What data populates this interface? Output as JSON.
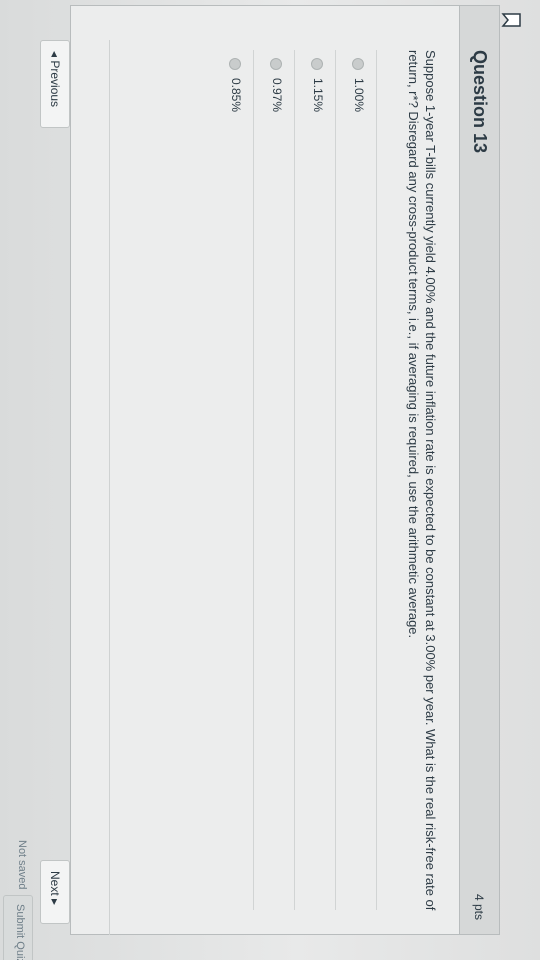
{
  "question": {
    "title": "Question 13",
    "points": "4 pts",
    "text": "Suppose 1-year T-bills currently yield 4.00% and the future inflation rate is expected to be constant at 3.00% per year. What is the real risk-free rate of return, r*? Disregard any cross-product terms, i.e., if averaging is required, use the arithmetic average."
  },
  "answers": [
    {
      "label": "1.00%"
    },
    {
      "label": "1.15%"
    },
    {
      "label": "0.97%"
    },
    {
      "label": "0.85%"
    }
  ],
  "nav": {
    "previous_label": "◂ Previous",
    "next_label": "Next ▸"
  },
  "footer": {
    "status": "Not saved",
    "submit_label": "Submit Quiz"
  },
  "colors": {
    "text": "#2d3b45",
    "header_bg": "#d6d8d8",
    "border": "#b8bcbd"
  },
  "icons": {
    "bookmark": "bookmark-icon",
    "radio": "radio-icon"
  }
}
